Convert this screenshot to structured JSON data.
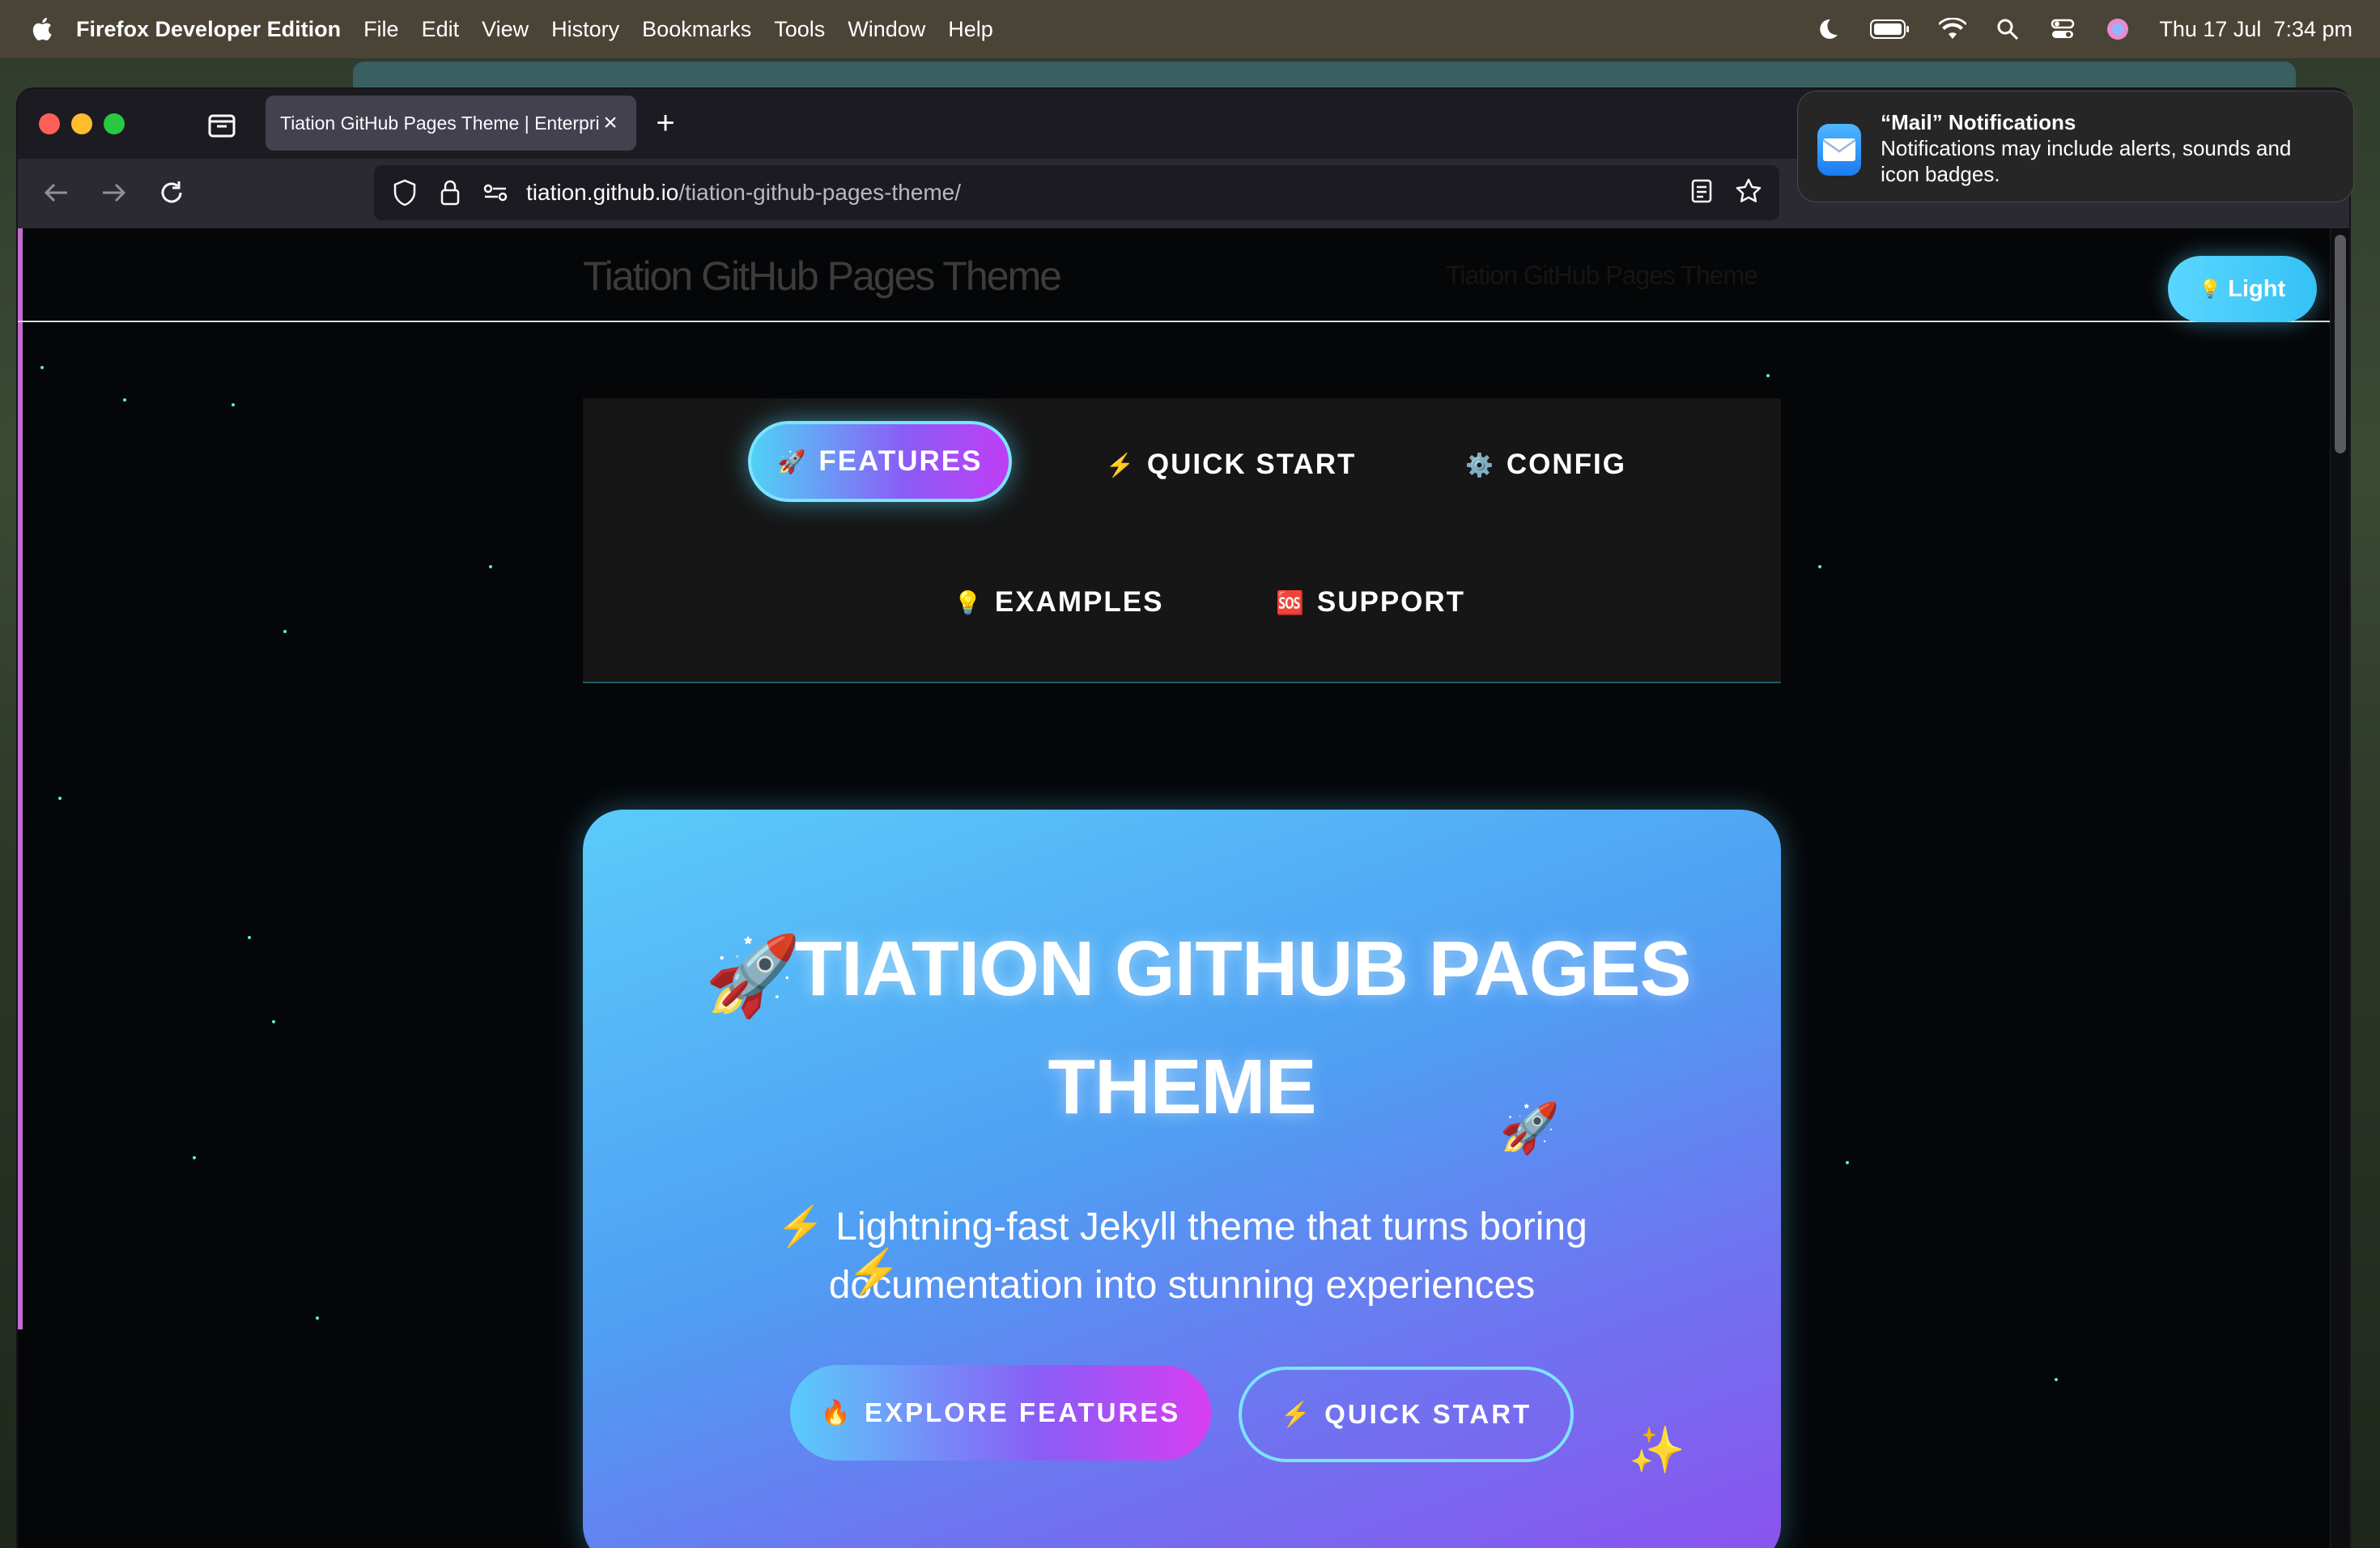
{
  "menubar": {
    "app_name": "Firefox Developer Edition",
    "menus": [
      "File",
      "Edit",
      "View",
      "History",
      "Bookmarks",
      "Tools",
      "Window",
      "Help"
    ],
    "datetime": "Thu 17 Jul  7:34 pm"
  },
  "browser": {
    "tab_title": "Tiation GitHub Pages Theme | Enterprise",
    "url_domain": "tiation.github.io",
    "url_path": "/tiation-github-pages-theme/"
  },
  "site": {
    "title": "Tiation GitHub Pages Theme",
    "title_ghost": "Tiation GitHub Pages Theme",
    "theme_toggle": "Light",
    "nav": [
      {
        "icon": "🚀",
        "label": "FEATURES"
      },
      {
        "icon": "⚡",
        "label": "QUICK START"
      },
      {
        "icon": "⚙️",
        "label": "CONFIG"
      },
      {
        "icon": "💡",
        "label": "EXAMPLES"
      },
      {
        "icon": "🆘",
        "label": "SUPPORT"
      }
    ],
    "hero": {
      "title_line1": "TIATION GITHUB PAGES",
      "title_line2": "THEME",
      "subtitle": "⚡ Lightning-fast Jekyll theme that turns boring documentation into stunning experiences",
      "primary_button": "EXPLORE FEATURES",
      "primary_icon": "🔥",
      "secondary_button": "QUICK START",
      "secondary_icon": "⚡"
    }
  },
  "notification": {
    "title": "“Mail” Notifications",
    "body": "Notifications may include alerts, sounds and icon badges."
  },
  "colors": {
    "accent_cyan": "#5acbfa",
    "accent_purple": "#8b5cf6",
    "accent_magenta": "#d83ef2",
    "page_bg": "#050608"
  }
}
